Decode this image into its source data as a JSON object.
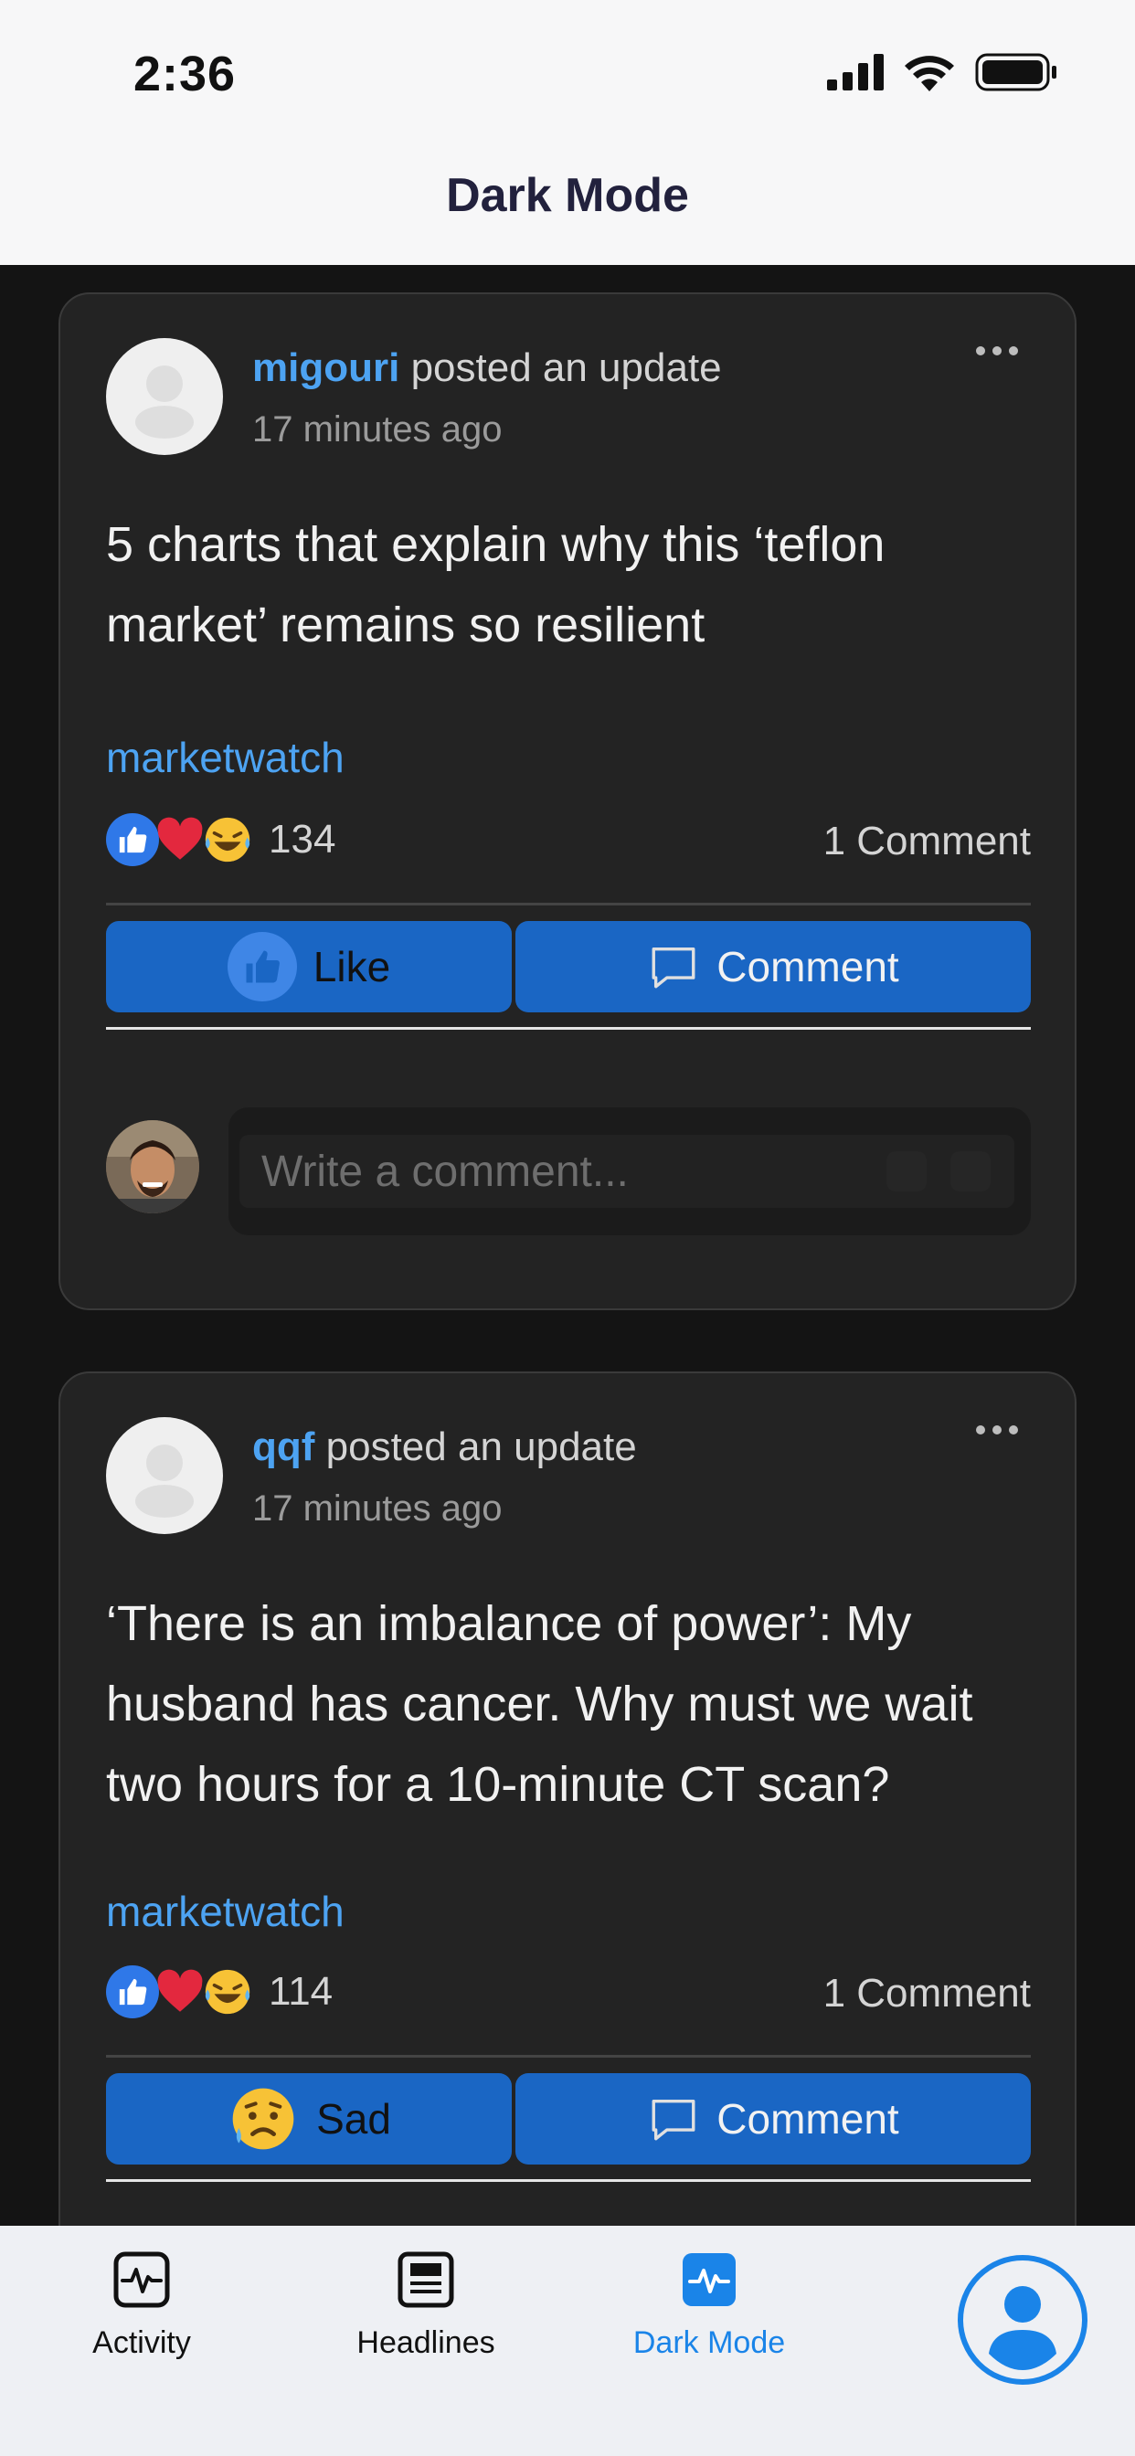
{
  "status_bar": {
    "time": "2:36"
  },
  "header": {
    "title": "Dark Mode"
  },
  "posts": [
    {
      "username": "migouri",
      "action": "posted an update",
      "time_ago": "17 minutes ago",
      "text": "5 charts that explain why this ‘teflon market’ remains so resilient",
      "source": "marketwatch",
      "reaction_count": "134",
      "comment_count": "1 Comment",
      "reaction_button": "Like",
      "comment_button": "Comment"
    },
    {
      "username": "qqf",
      "action": "posted an update",
      "time_ago": "17 minutes ago",
      "text": "‘There is an imbalance of power’: My husband has cancer. Why must we wait two hours for a 10-minute CT scan?",
      "source": "marketwatch",
      "reaction_count": "114",
      "comment_count": "1 Comment",
      "reaction_button": "Sad",
      "comment_button": "Comment"
    }
  ],
  "comment_box": {
    "placeholder": "Write a comment..."
  },
  "tabbar": {
    "items": [
      {
        "label": "Activity",
        "icon": "activity-icon"
      },
      {
        "label": "Headlines",
        "icon": "newspaper-icon"
      },
      {
        "label": "Dark Mode",
        "icon": "pulse-icon",
        "active": true
      }
    ],
    "profile_icon": "profile-icon"
  },
  "colors": {
    "accent": "#1a84e8",
    "link": "#4da3f2",
    "button": "#1a66c4",
    "card": "#232323",
    "background": "#141414"
  }
}
